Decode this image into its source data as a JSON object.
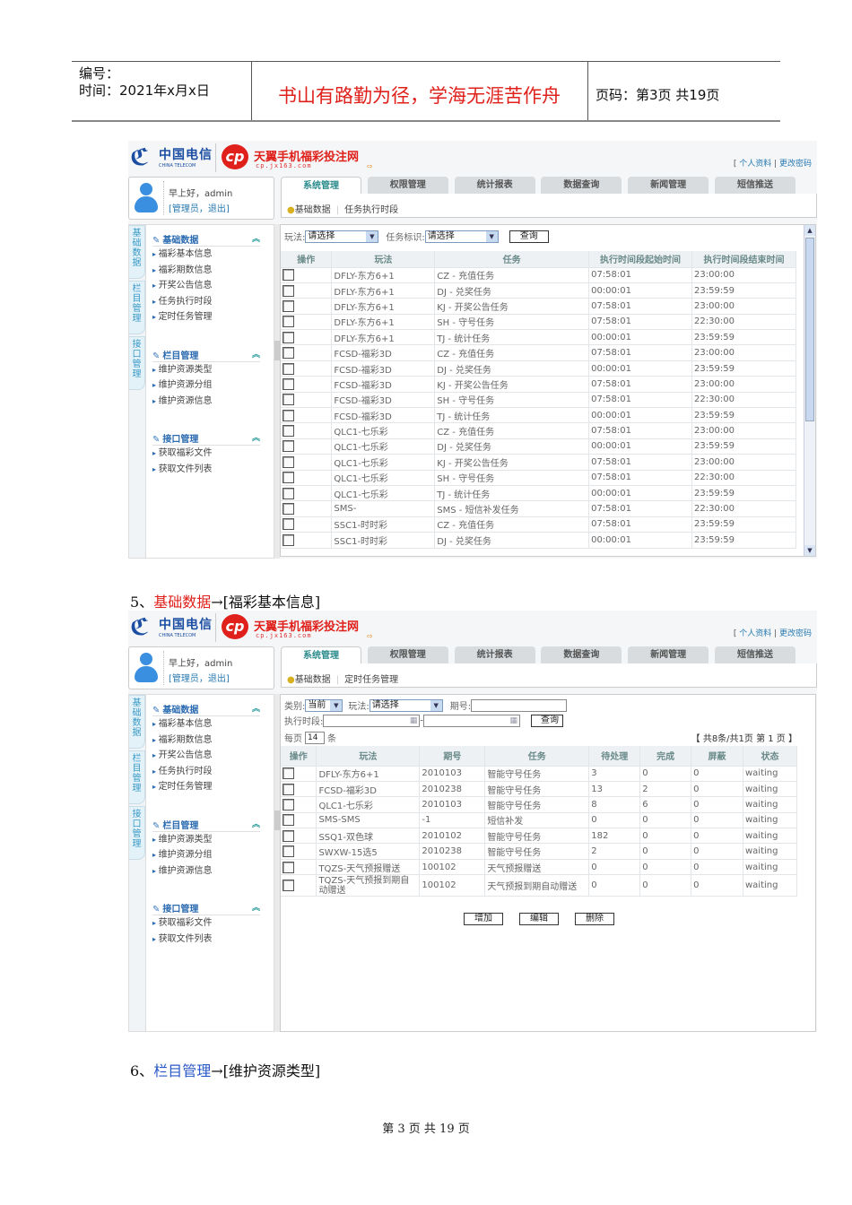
{
  "doc_header": {
    "number_label": "编号：",
    "time_label": "时间：2021年x月x日",
    "motto": "书山有路勤为径，学海无涯苦作舟",
    "page_code": "页码：第3页 共19页"
  },
  "footer": "第 3 页 共 19 页",
  "captions": [
    {
      "num": "5、",
      "link": "基础数据",
      "link_color": "#e0201a",
      "rest": "→[福彩基本信息]"
    },
    {
      "num": "6、",
      "link": "栏目管理",
      "link_color": "#2a58c8",
      "rest": "→[维护资源类型]"
    }
  ],
  "app": {
    "brand_cn": "中国电信",
    "brand_en": "CHINA TELECOM",
    "site_name": "天翼手机福彩投注网",
    "site_url": "cp.jx163.com",
    "top_links": [
      "个人资料",
      "更改密码"
    ],
    "greeting": "早上好，admin",
    "role": "管理员",
    "logout": "退出",
    "tabs": [
      "系统管理",
      "权限管理",
      "统计报表",
      "数据查询",
      "新闻管理",
      "短信推送"
    ],
    "vtabs": [
      "基础数据",
      "栏目管理",
      "接口管理"
    ],
    "groups": [
      {
        "title": "基础数据",
        "items": [
          "福彩基本信息",
          "福彩期数信息",
          "开奖公告信息",
          "任务执行时段",
          "定时任务管理"
        ]
      },
      {
        "title": "栏目管理",
        "items": [
          "维护资源类型",
          "维护资源分组",
          "维护资源信息"
        ]
      },
      {
        "title": "接口管理",
        "items": [
          "获取福彩文件",
          "获取文件列表"
        ]
      }
    ]
  },
  "screen1": {
    "breadcrumb": [
      "基础数据",
      "任务执行时段"
    ],
    "filters": {
      "play_label": "玩法:",
      "play_value": "请选择",
      "task_label": "任务标识:",
      "task_value": "请选择",
      "query": "查询"
    },
    "columns": [
      "操作",
      "玩法",
      "任务",
      "执行时间段起始时间",
      "执行时间段结束时间"
    ],
    "rows": [
      [
        "DFLY-东方6+1",
        "CZ - 充值任务",
        "07:58:01",
        "23:00:00"
      ],
      [
        "DFLY-东方6+1",
        "DJ - 兑奖任务",
        "00:00:01",
        "23:59:59"
      ],
      [
        "DFLY-东方6+1",
        "KJ - 开奖公告任务",
        "07:58:01",
        "23:00:00"
      ],
      [
        "DFLY-东方6+1",
        "SH - 守号任务",
        "07:58:01",
        "22:30:00"
      ],
      [
        "DFLY-东方6+1",
        "TJ - 统计任务",
        "00:00:01",
        "23:59:59"
      ],
      [
        "FCSD-福彩3D",
        "CZ - 充值任务",
        "07:58:01",
        "23:00:00"
      ],
      [
        "FCSD-福彩3D",
        "DJ - 兑奖任务",
        "00:00:01",
        "23:59:59"
      ],
      [
        "FCSD-福彩3D",
        "KJ - 开奖公告任务",
        "07:58:01",
        "23:00:00"
      ],
      [
        "FCSD-福彩3D",
        "SH - 守号任务",
        "07:58:01",
        "22:30:00"
      ],
      [
        "FCSD-福彩3D",
        "TJ - 统计任务",
        "00:00:01",
        "23:59:59"
      ],
      [
        "QLC1-七乐彩",
        "CZ - 充值任务",
        "07:58:01",
        "23:00:00"
      ],
      [
        "QLC1-七乐彩",
        "DJ - 兑奖任务",
        "00:00:01",
        "23:59:59"
      ],
      [
        "QLC1-七乐彩",
        "KJ - 开奖公告任务",
        "07:58:01",
        "23:00:00"
      ],
      [
        "QLC1-七乐彩",
        "SH - 守号任务",
        "07:58:01",
        "22:30:00"
      ],
      [
        "QLC1-七乐彩",
        "TJ - 统计任务",
        "00:00:01",
        "23:59:59"
      ],
      [
        "SMS-",
        "SMS - 短信补发任务",
        "07:58:01",
        "22:30:00"
      ],
      [
        "SSC1-时时彩",
        "CZ - 充值任务",
        "07:58:01",
        "23:59:59"
      ],
      [
        "SSC1-时时彩",
        "DJ - 兑奖任务",
        "00:00:01",
        "23:59:59"
      ]
    ]
  },
  "screen2": {
    "breadcrumb": [
      "基础数据",
      "定时任务管理"
    ],
    "filters": {
      "type_label": "类别:",
      "type_value": "当前",
      "play_label": "玩法:",
      "play_value": "请选择",
      "period_label": "期号:",
      "time_label": "执行时段:",
      "query": "查询"
    },
    "per_page_label": "每页",
    "per_page": "14",
    "per_page_unit": "条",
    "pager": "【 共8条/共1页 第 1 页 】",
    "columns": [
      "操作",
      "玩法",
      "期号",
      "任务",
      "待处理",
      "完成",
      "屏蔽",
      "状态"
    ],
    "rows": [
      [
        "DFLY-东方6+1",
        "2010103",
        "智能守号任务",
        "3",
        "0",
        "0",
        "waiting"
      ],
      [
        "FCSD-福彩3D",
        "2010238",
        "智能守号任务",
        "13",
        "2",
        "0",
        "waiting"
      ],
      [
        "QLC1-七乐彩",
        "2010103",
        "智能守号任务",
        "8",
        "6",
        "0",
        "waiting"
      ],
      [
        "SMS-SMS",
        "-1",
        "短信补发",
        "0",
        "0",
        "0",
        "waiting"
      ],
      [
        "SSQ1-双色球",
        "2010102",
        "智能守号任务",
        "182",
        "0",
        "0",
        "waiting"
      ],
      [
        "SWXW-15选5",
        "2010238",
        "智能守号任务",
        "2",
        "0",
        "0",
        "waiting"
      ],
      [
        "TQZS-天气预报赠送",
        "100102",
        "天气预报赠送",
        "0",
        "0",
        "0",
        "waiting"
      ],
      [
        "TQZS-天气预报到期自动赠送",
        "100102",
        "天气预报到期自动赠送",
        "0",
        "0",
        "0",
        "waiting"
      ]
    ],
    "buttons": [
      "增加",
      "编辑",
      "删除"
    ]
  }
}
